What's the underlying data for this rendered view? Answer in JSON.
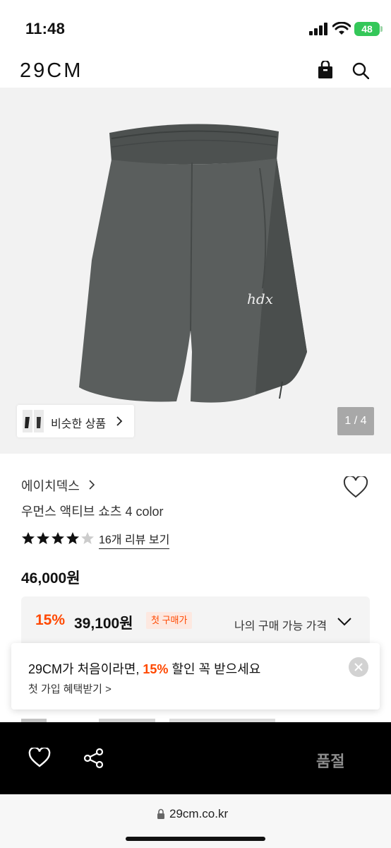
{
  "status_bar": {
    "time": "11:48",
    "battery": "48"
  },
  "header": {
    "logo": "29CM",
    "icons": [
      "shopping-bag-icon",
      "search-icon"
    ]
  },
  "gallery": {
    "similar_label": "비슷한 상품",
    "pager": "1 / 4",
    "product_image": "gray-shorts"
  },
  "product": {
    "brand": "에이치덱스",
    "title": "우먼스 액티브 쇼츠 4 color",
    "rating": 4.5,
    "review_link": "16개 리뷰 보기",
    "price": "46,000원"
  },
  "discount": {
    "percent": "15%",
    "price": "39,100원",
    "badge": "첫 구매가",
    "my_price_label": "나의 구매 가능 가격"
  },
  "toast": {
    "line1_prefix": "29CM가 처음이라면, ",
    "line1_highlight": "15%",
    "line1_suffix": " 할인 꼭 받으세요",
    "line2": "첫 가입 혜택받기 >"
  },
  "bottom_bar": {
    "status": "품절"
  },
  "browser": {
    "url": "29cm.co.kr"
  },
  "colors": {
    "accent": "#ff4800",
    "bar": "#000000",
    "hero_bg": "#f2f2f2"
  }
}
